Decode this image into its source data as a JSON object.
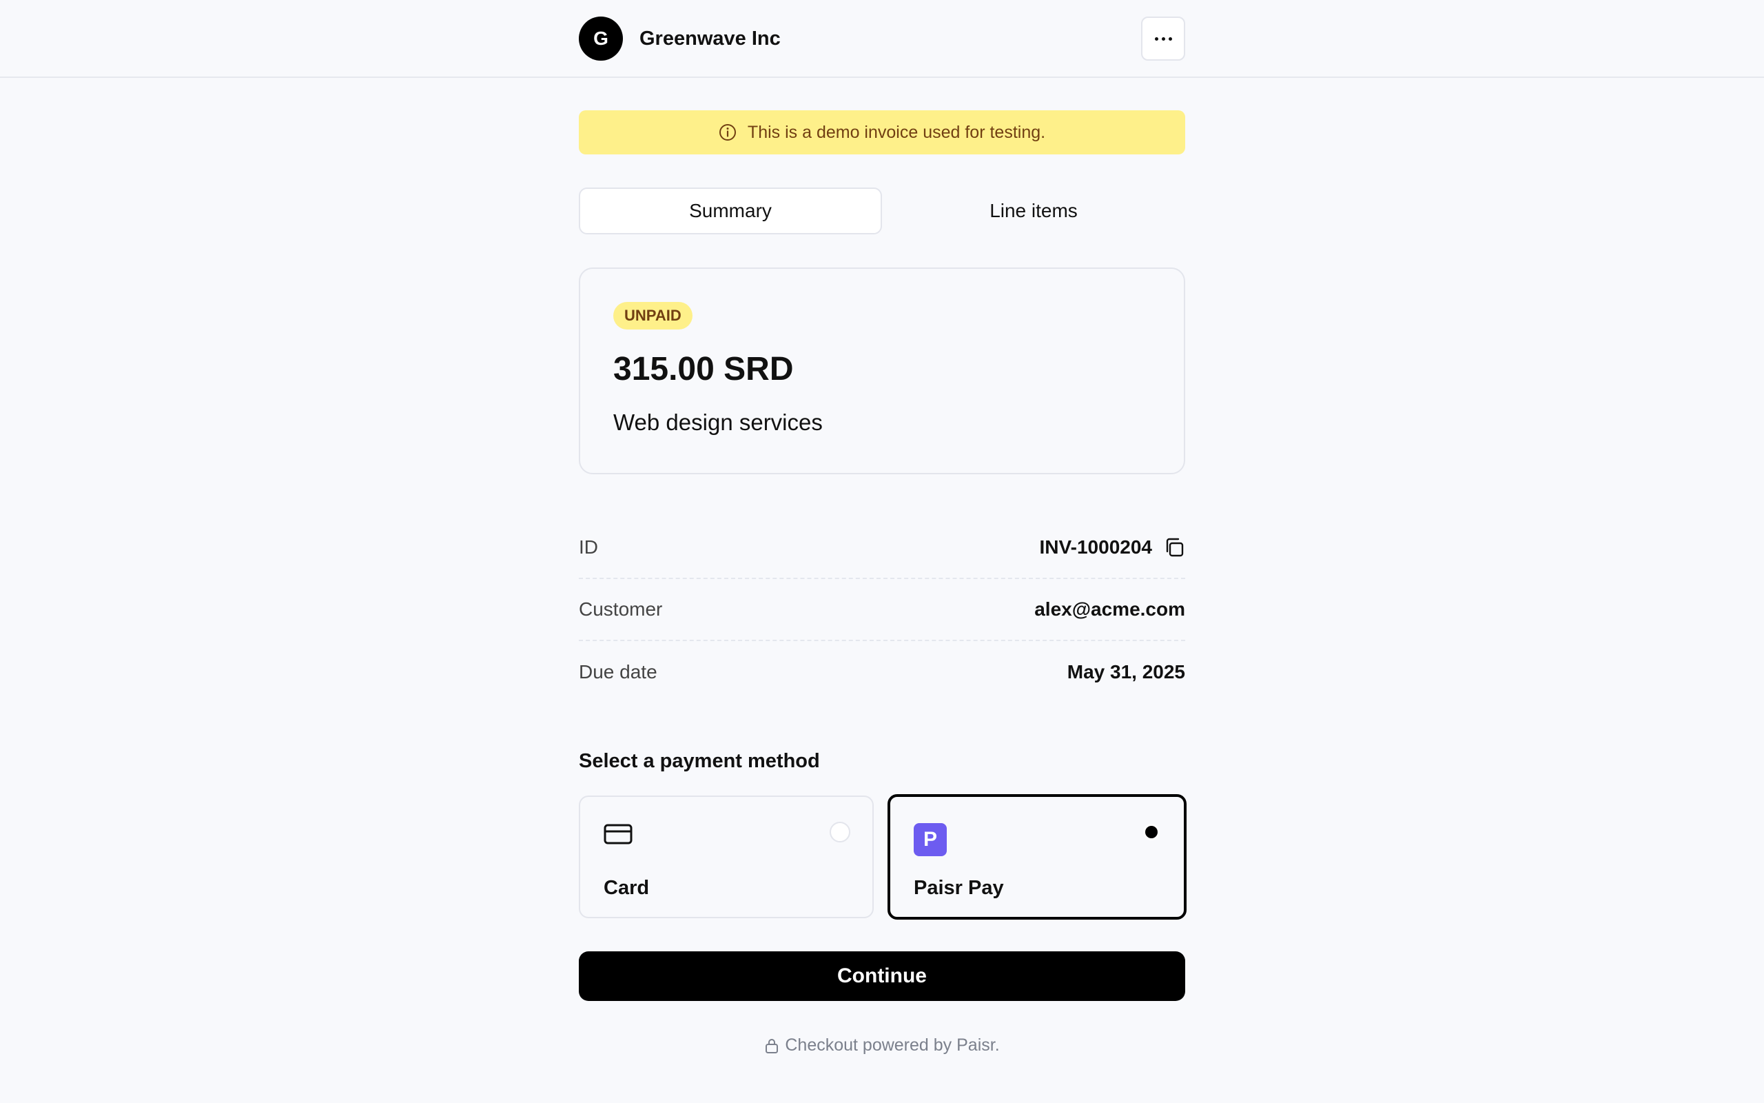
{
  "header": {
    "avatar_letter": "G",
    "company_name": "Greenwave Inc"
  },
  "banner": {
    "text": "This is a demo invoice used for testing."
  },
  "tabs": [
    {
      "label": "Summary",
      "active": true
    },
    {
      "label": "Line items",
      "active": false
    }
  ],
  "summary": {
    "status": "UNPAID",
    "amount": "315.00 SRD",
    "description": "Web design services"
  },
  "details": [
    {
      "label": "ID",
      "value": "INV-1000204"
    },
    {
      "label": "Customer",
      "value": "alex@acme.com"
    },
    {
      "label": "Due date",
      "value": "May 31, 2025"
    }
  ],
  "payment": {
    "title": "Select a payment method",
    "methods": [
      {
        "label": "Card",
        "icon": "credit-card-icon",
        "selected": false
      },
      {
        "label": "Paisr Pay",
        "icon": "paisr-pay-logo-icon",
        "selected": true
      }
    ],
    "continue_label": "Continue"
  },
  "footer": {
    "text": "Checkout powered by Paisr."
  },
  "colors": {
    "banner_bg": "#fef08a",
    "banner_text": "#713f12",
    "primary": "#000000",
    "paisr_brand": "#6d5cf0"
  }
}
